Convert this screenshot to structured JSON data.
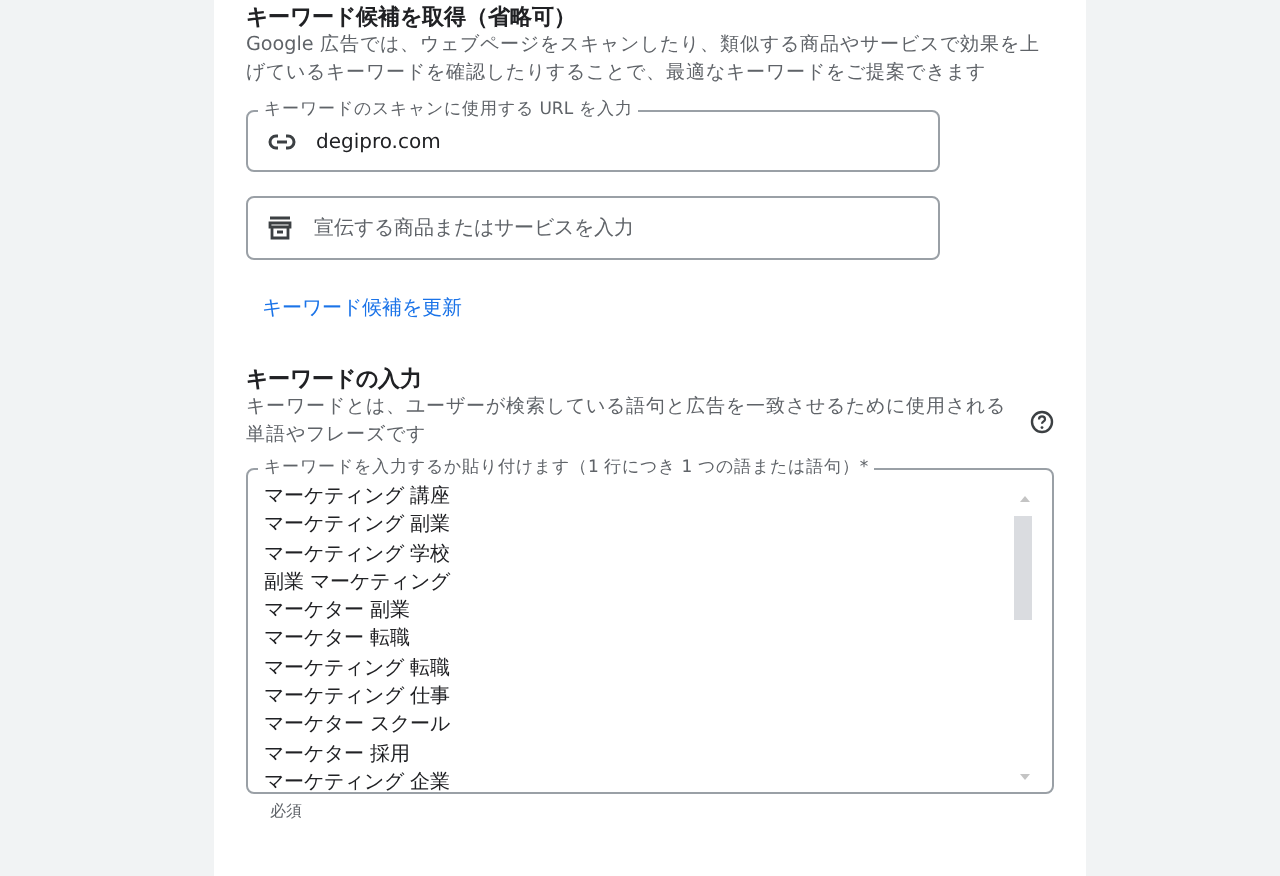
{
  "suggest": {
    "title": "キーワード候補を取得（省略可）",
    "description": "Google 広告では、ウェブページをスキャンしたり、類似する商品やサービスで効果を上げているキーワードを確認したりすることで、最適なキーワードをご提案できます",
    "url_field": {
      "label": "キーワードのスキャンに使用する URL を入力",
      "value": "degipro.com"
    },
    "product_field": {
      "placeholder": "宣伝する商品またはサービスを入力"
    },
    "refresh_link": "キーワード候補を更新"
  },
  "keywords": {
    "title": "キーワードの入力",
    "description": "キーワードとは、ユーザーが検索している語句と広告を一致させるために使用される単語やフレーズです",
    "field_label": "キーワードを入力するか貼り付けます（1 行につき 1 つの語または語句）*",
    "lines": [
      "マーケティング 講座",
      "マーケティング 副業",
      "マーケティング 学校",
      "副業 マーケティング",
      "マーケター 副業",
      "マーケター 転職",
      "マーケティング 転職",
      "マーケティング 仕事",
      "マーケター スクール",
      "マーケター 採用",
      "マーケティング 企業"
    ],
    "helper": "必須"
  }
}
